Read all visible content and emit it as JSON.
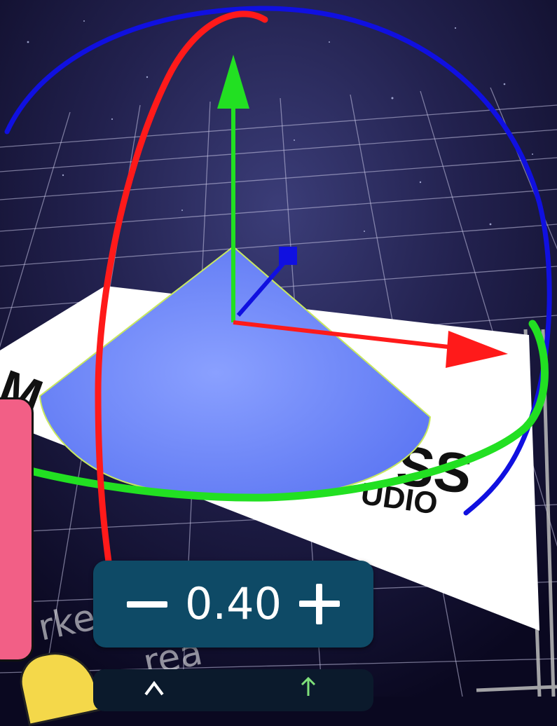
{
  "stepper": {
    "value": "0.40",
    "minus_label": "decrease value",
    "plus_label": "increase value"
  },
  "marker_text": {
    "logo_left": "M",
    "logo_right": "SS",
    "logo_sub": "UDIO",
    "floor_label_1": "rker",
    "floor_label_2": "rea"
  },
  "icons": {
    "move_x": "arrow-red-icon",
    "move_y": "arrow-green-icon",
    "move_z": "arrow-blue-icon",
    "rotate_x": "ring-red-icon",
    "rotate_y": "ring-green-icon",
    "rotate_z": "ring-blue-icon",
    "tool_left": "cursor-icon",
    "tool_right": "arrow-up-icon"
  },
  "colors": {
    "x_axis": "#ff1a1a",
    "y_axis": "#22e022",
    "z_axis": "#1010e0",
    "cone": "#7089ff",
    "stepper_bg": "#0e4a66",
    "panel": "#f25f86"
  }
}
